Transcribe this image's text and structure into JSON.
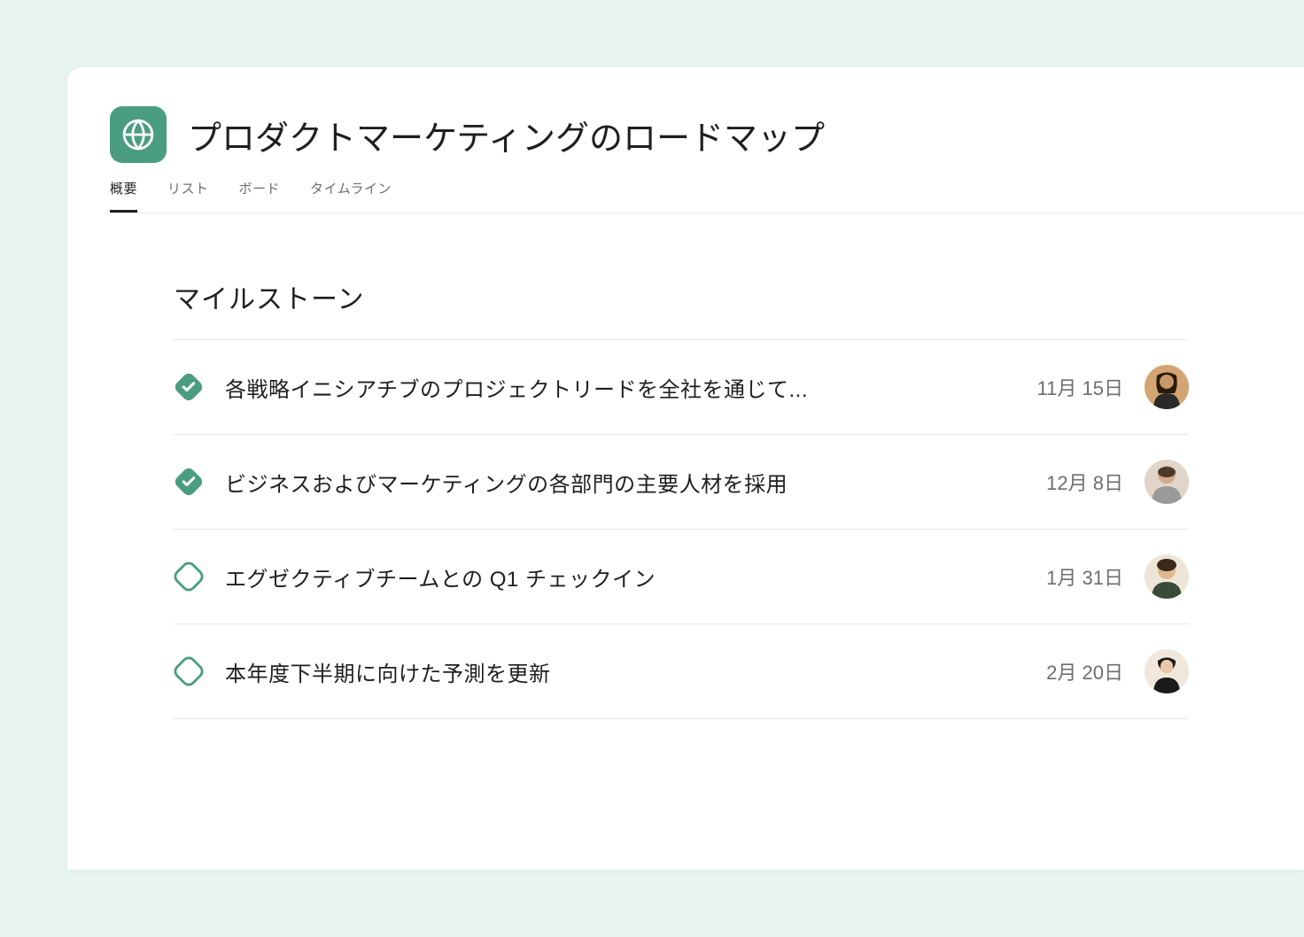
{
  "project": {
    "title": "プロダクトマーケティングのロードマップ",
    "icon": "globe"
  },
  "tabs": [
    {
      "label": "概要",
      "active": true
    },
    {
      "label": "リスト",
      "active": false
    },
    {
      "label": "ボード",
      "active": false
    },
    {
      "label": "タイムライン",
      "active": false
    }
  ],
  "section": {
    "title": "マイルストーン"
  },
  "milestones": [
    {
      "title": "各戦略イニシアチブのプロジェクトリードを全社を通じて...",
      "date": "11月 15日",
      "completed": true,
      "assignee": "avatar-1"
    },
    {
      "title": "ビジネスおよびマーケティングの各部門の主要人材を採用",
      "date": "12月 8日",
      "completed": true,
      "assignee": "avatar-2"
    },
    {
      "title": "エグゼクティブチームとの Q1 チェックイン",
      "date": "1月 31日",
      "completed": false,
      "assignee": "avatar-3"
    },
    {
      "title": "本年度下半期に向けた予測を更新",
      "date": "2月 20日",
      "completed": false,
      "assignee": "avatar-4"
    }
  ],
  "colors": {
    "accent": "#4a9d7f",
    "text_primary": "#1e1f21",
    "text_secondary": "#6d6e6f"
  }
}
